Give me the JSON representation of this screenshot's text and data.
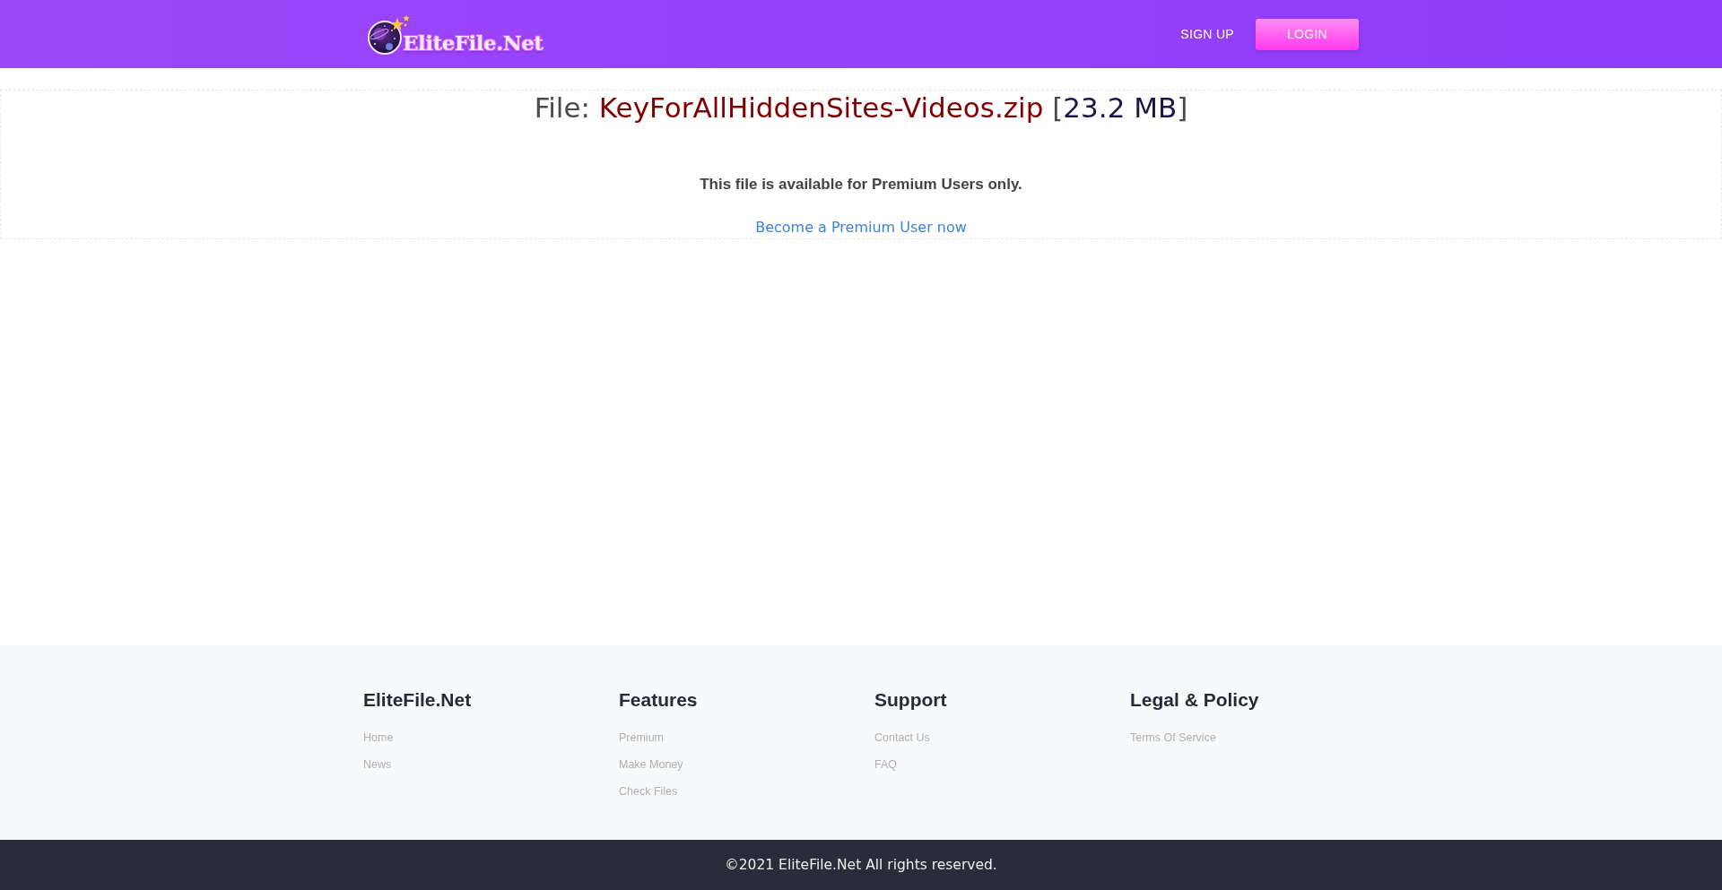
{
  "header": {
    "logo_text": "EliteFile.Net",
    "nav": [
      {
        "label": "SIGN UP",
        "kind": "link"
      },
      {
        "label": "LOGIN",
        "kind": "button"
      }
    ]
  },
  "file": {
    "label": "File:",
    "name": "KeyForAllHiddenSites-Videos.zip",
    "size_open": "[",
    "size": "23.2 MB",
    "size_close": "]",
    "notice": "This file is available for Premium Users only.",
    "link": "Become a Premium User now"
  },
  "footer": {
    "columns": [
      {
        "title": "EliteFile.Net",
        "links": [
          "Home",
          "News"
        ]
      },
      {
        "title": "Features",
        "links": [
          "Premium",
          "Make Money",
          "Check Files"
        ]
      },
      {
        "title": "Support",
        "links": [
          "Contact Us",
          "FAQ"
        ]
      },
      {
        "title": "Legal & Policy",
        "links": [
          "Terms Of Service"
        ]
      }
    ]
  },
  "copyright": "©2021 EliteFile.Net All rights reserved."
}
